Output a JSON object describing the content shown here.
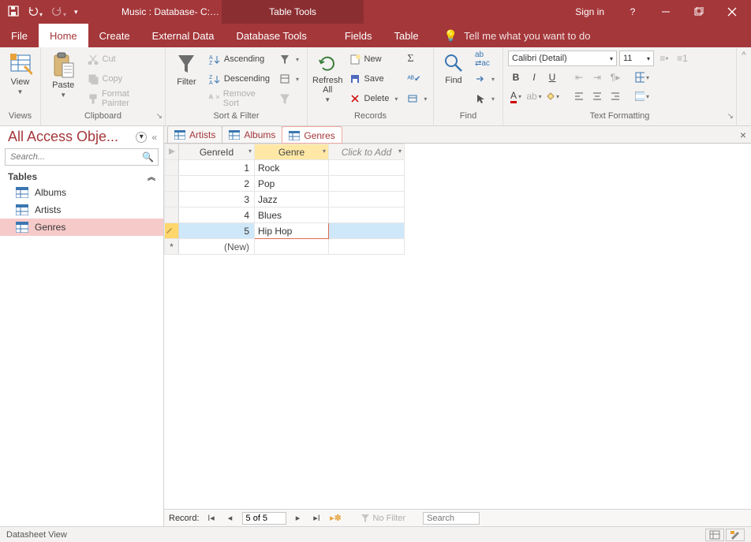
{
  "title": "Music : Database- C:\\Users\\Fred\\Docume...",
  "context_tab": "Table Tools",
  "signin": "Sign in",
  "menu": {
    "file": "File",
    "home": "Home",
    "create": "Create",
    "external": "External Data",
    "dbtools": "Database Tools",
    "fields": "Fields",
    "table": "Table",
    "tellme": "Tell me what you want to do"
  },
  "ribbon": {
    "views": {
      "label": "Views",
      "view": "View"
    },
    "clipboard": {
      "label": "Clipboard",
      "paste": "Paste",
      "cut": "Cut",
      "copy": "Copy",
      "fmt": "Format Painter"
    },
    "sortfilter": {
      "label": "Sort & Filter",
      "filter": "Filter",
      "asc": "Ascending",
      "desc": "Descending",
      "remove": "Remove Sort"
    },
    "records": {
      "label": "Records",
      "refresh": "Refresh All",
      "new": "New",
      "save": "Save",
      "delete": "Delete"
    },
    "find": {
      "label": "Find",
      "find": "Find"
    },
    "textfmt": {
      "label": "Text Formatting",
      "fontname": "Calibri (Detail)",
      "fontsize": "11"
    }
  },
  "nav": {
    "title": "All Access Obje...",
    "search": "Search...",
    "group": "Tables",
    "items": [
      "Albums",
      "Artists",
      "Genres"
    ],
    "selected": 2
  },
  "tabs": [
    "Artists",
    "Albums",
    "Genres"
  ],
  "active_tab": 2,
  "table": {
    "columns": [
      "GenreId",
      "Genre"
    ],
    "clickadd": "Click to Add",
    "rows": [
      {
        "id": "1",
        "v": "Rock"
      },
      {
        "id": "2",
        "v": "Pop"
      },
      {
        "id": "3",
        "v": "Jazz"
      },
      {
        "id": "4",
        "v": "Blues"
      },
      {
        "id": "5",
        "v": "Hip Hop"
      }
    ],
    "newlabel": "(New)",
    "active_row": 4
  },
  "recnav": {
    "label": "Record:",
    "pos": "5 of 5",
    "nofilter": "No Filter",
    "search": "Search"
  },
  "status": "Datasheet View"
}
